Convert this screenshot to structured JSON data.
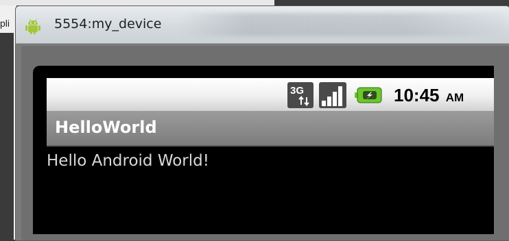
{
  "background": {
    "left_text": "pli"
  },
  "window": {
    "title": "5554:my_device",
    "icon": "android-icon"
  },
  "statusbar": {
    "network_icon": "3g-icon",
    "signal_icon": "signal-icon",
    "battery_icon": "battery-charging-icon",
    "time": "10:45",
    "ampm": "AM"
  },
  "app": {
    "title": "HelloWorld",
    "content": "Hello Android World!"
  },
  "colors": {
    "battery_green": "#6cc62c",
    "title_bar_gray": "#8a8a8a",
    "content_text": "#d9d9d9"
  }
}
